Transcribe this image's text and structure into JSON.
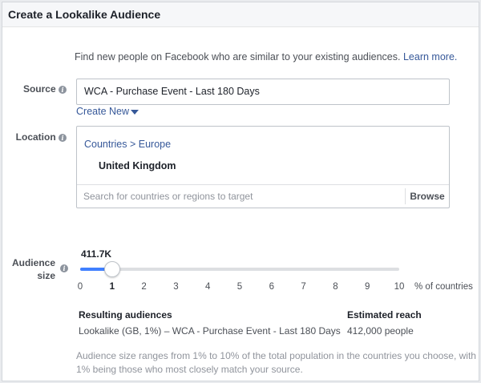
{
  "dialog": {
    "title": "Create a Lookalike Audience"
  },
  "intro": {
    "text": "Find new people on Facebook who are similar to your existing audiences.",
    "link": "Learn more."
  },
  "source": {
    "label": "Source",
    "value": "WCA - Purchase Event - Last 180 Days",
    "create_new": "Create New"
  },
  "location": {
    "label": "Location",
    "breadcrumb": "Countries > Europe",
    "selected_country": "United Kingdom",
    "search_placeholder": "Search for countries or regions to target",
    "browse_label": "Browse"
  },
  "audience_size": {
    "label_line1": "Audience",
    "label_line2": "size",
    "current_value": "411.7K",
    "slider_value_percent": 1,
    "slider_min": 0,
    "slider_max": 10,
    "ticks": [
      "0",
      "1",
      "2",
      "3",
      "4",
      "5",
      "6",
      "7",
      "8",
      "9",
      "10"
    ],
    "unit": "% of countries"
  },
  "results": {
    "audiences_header": "Resulting audiences",
    "audiences_value": "Lookalike (GB, 1%) – WCA - Purchase Event - Last 180 Days",
    "reach_header": "Estimated reach",
    "reach_value": "412,000 people"
  },
  "note": "Audience size ranges from 1% to 10% of the total population in the countries you choose, with 1% being those who most closely match your source.",
  "colors": {
    "link": "#365899",
    "slider_fill": "#4080ff",
    "info_icon": "#8d949e"
  }
}
